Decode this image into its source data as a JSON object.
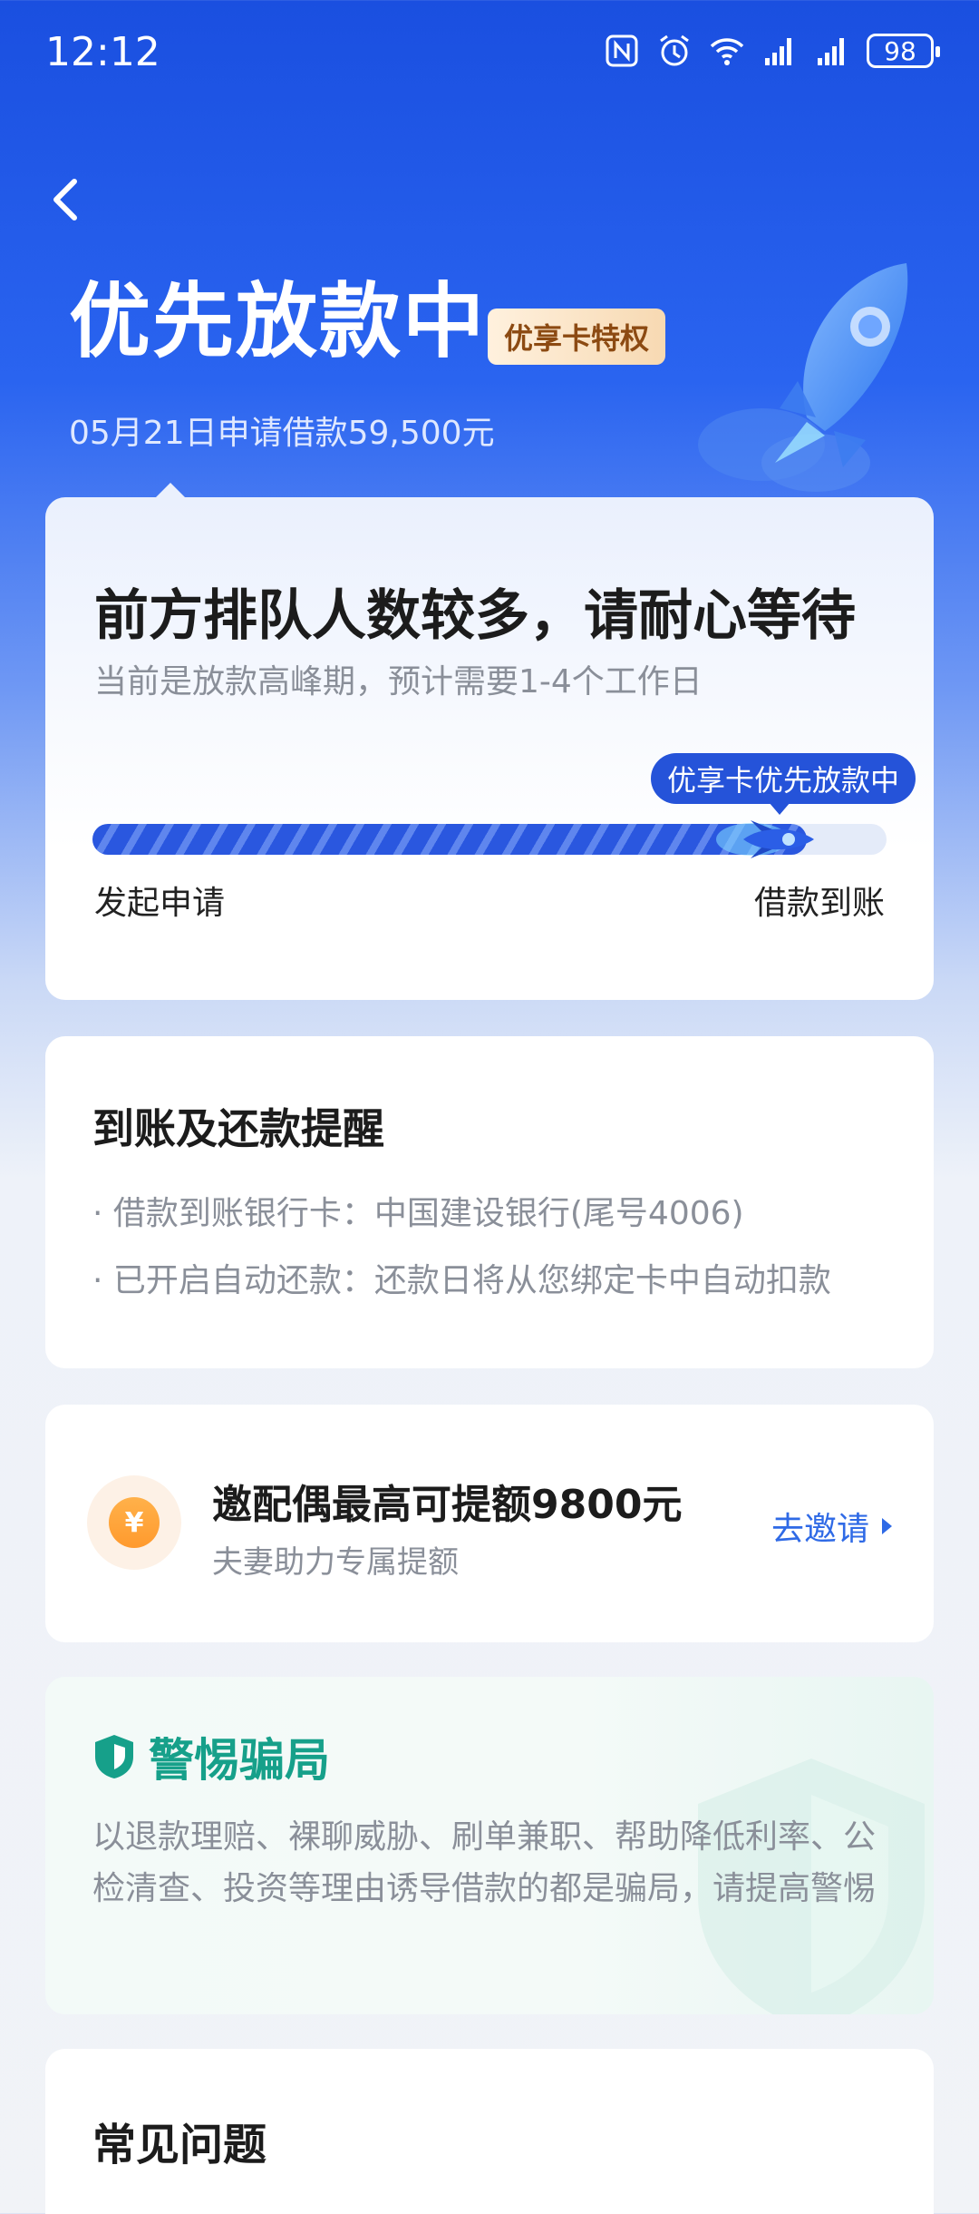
{
  "status_bar": {
    "time": "12:12",
    "battery": "98"
  },
  "header": {
    "title": "优先放款中",
    "badge": "优享卡特权",
    "subtitle": "05月21日申请借款59,500元"
  },
  "progress_card": {
    "title": "前方排队人数较多，请耐心等待",
    "subtitle": "当前是放款高峰期，预计需要1-4个工作日",
    "bubble": "优享卡优先放款中",
    "progress": 0.9,
    "start_label": "发起申请",
    "end_label": "借款到账"
  },
  "reminder_card": {
    "title": "到账及还款提醒",
    "items": [
      "· 借款到账银行卡：中国建设银行(尾号4006)",
      "· 已开启自动还款：还款日将从您绑定卡中自动扣款"
    ]
  },
  "invite_card": {
    "coin_symbol": "¥",
    "title": "邀配偶最高可提额9800元",
    "subtitle": "夫妻助力专属提额",
    "action": "去邀请"
  },
  "warning_card": {
    "title": "警惕骗局",
    "body": "以退款理赔、裸聊威胁、刷单兼职、帮助降低利率、公检清查、投资等理由诱导借款的都是骗局，请提高警惕"
  },
  "faq_card": {
    "title": "常见问题"
  },
  "colors": {
    "brand_blue": "#2553d9",
    "warning_green": "#16a08a",
    "link_blue": "#2f6ae6"
  }
}
